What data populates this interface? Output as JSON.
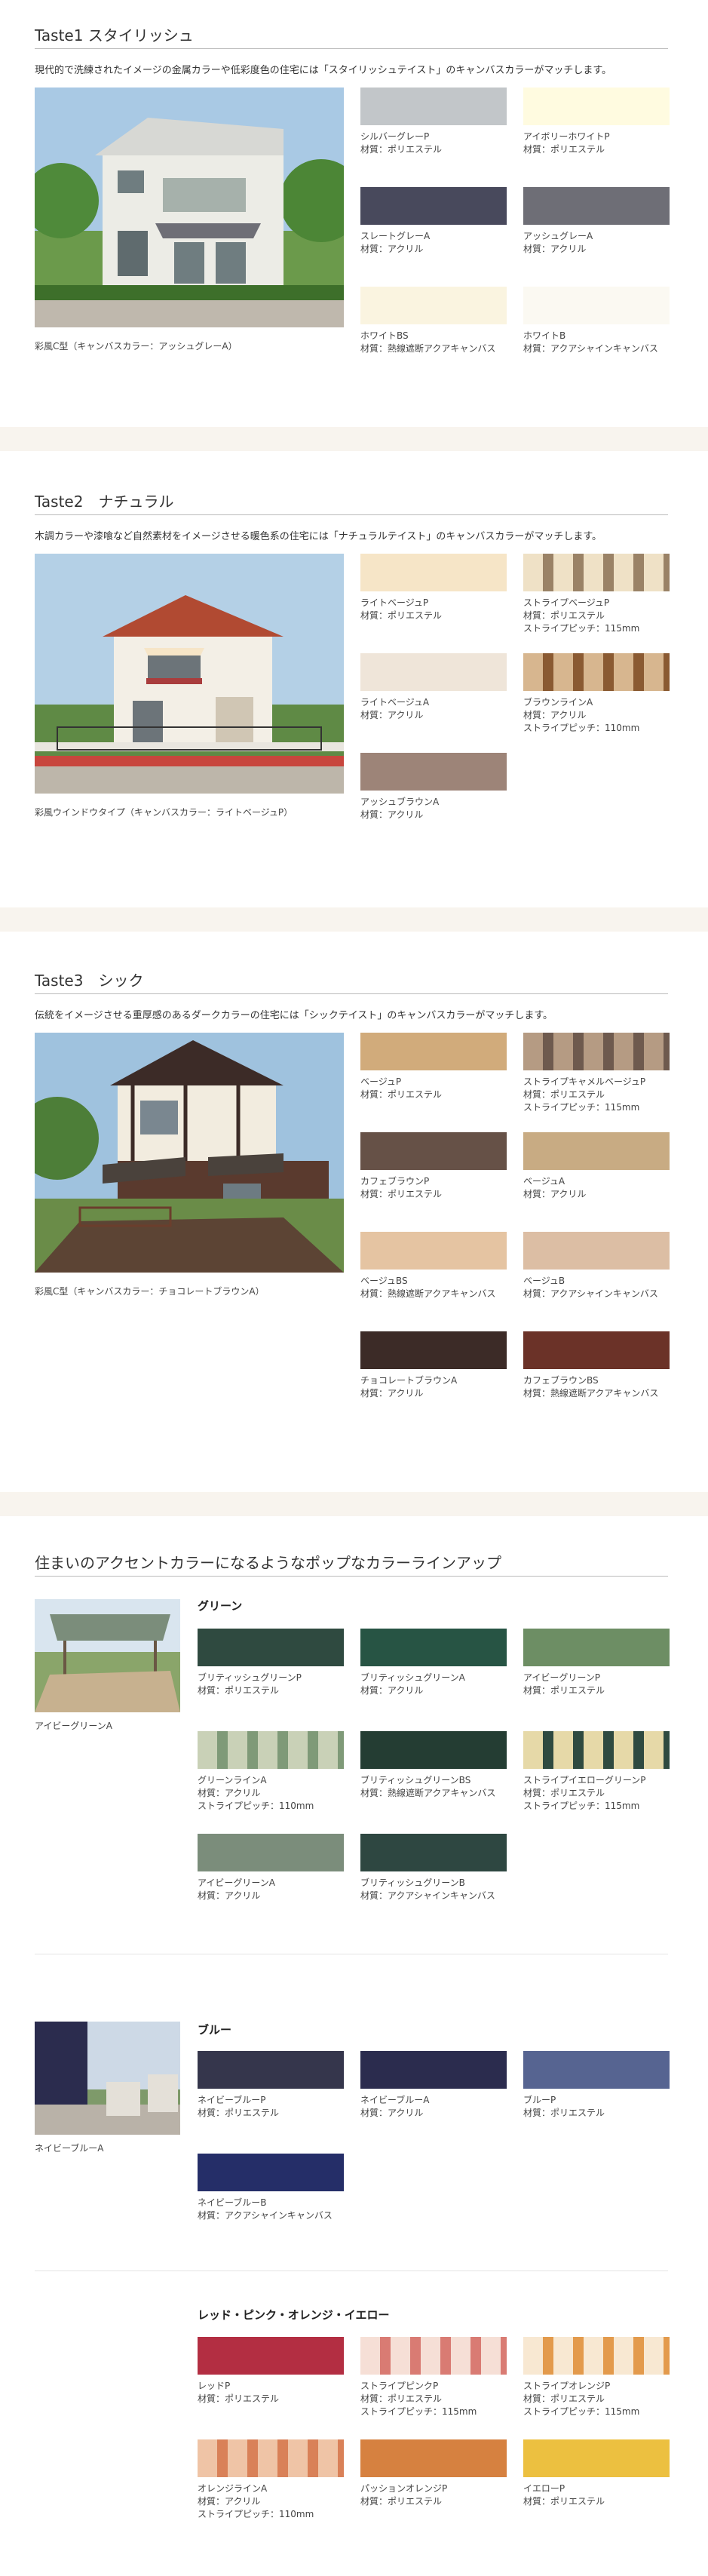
{
  "tastes": [
    {
      "title": "Taste1 スタイリッシュ",
      "desc": "現代的で洗練されたイメージの金属カラーや低彩度色の住宅には「スタイリッシュテイスト」のキャンバスカラーがマッチします。",
      "caption": "彩風C型（キャンバスカラー：アッシュグレーA）",
      "swatches": [
        {
          "name": "シルバーグレーP",
          "lines": [
            "材質：ポリエステル"
          ],
          "color": "#c2c6c9"
        },
        {
          "name": "アイボリーホワイトP",
          "lines": [
            "材質：ポリエステル"
          ],
          "color": "#fffbe0"
        },
        {
          "name": "スレートグレーA",
          "lines": [
            "材質：アクリル"
          ],
          "color": "#48495c"
        },
        {
          "name": "アッシュグレーA",
          "lines": [
            "材質：アクリル"
          ],
          "color": "#6e6e76"
        },
        {
          "name": "ホワイトBS",
          "lines": [
            "材質：熱線遮断アクアキャンバス"
          ],
          "color": "#faf4e0"
        },
        {
          "name": "ホワイトB",
          "lines": [
            "材質：アクアシャインキャンバス"
          ],
          "color": "#fbf9f2"
        }
      ]
    },
    {
      "title": "Taste2　ナチュラル",
      "desc": "木調カラーや漆喰など自然素材をイメージさせる暖色系の住宅には「ナチュラルテイスト」のキャンバスカラーがマッチします。",
      "caption": "彩風ウインドウタイプ（キャンバスカラー：ライトベージュP）",
      "swatches": [
        {
          "name": "ライトベージュP",
          "lines": [
            "材質：ポリエステル"
          ],
          "color": "#f6e5c7"
        },
        {
          "name": "ストライプベージュP",
          "lines": [
            "材質：ポリエステル",
            "ストライプピッチ：115mm"
          ],
          "color": "#efe1c6",
          "stripe": "#9a8266"
        },
        {
          "name": "ライトベージュA",
          "lines": [
            "材質：アクリル"
          ],
          "color": "#efe5d9"
        },
        {
          "name": "ブラウンラインA",
          "lines": [
            "材質：アクリル",
            "ストライプピッチ：110mm"
          ],
          "color": "#d7b68f",
          "stripe": "#8a5a32"
        },
        {
          "name": "アッシュブラウンA",
          "lines": [
            "材質：アクリル"
          ],
          "color": "#9d8478"
        }
      ]
    },
    {
      "title": "Taste3　シック",
      "desc": "伝統をイメージさせる重厚感のあるダークカラーの住宅には「シックテイスト」のキャンバスカラーがマッチします。",
      "caption": "彩風C型（キャンバスカラー：チョコレートブラウンA）",
      "swatches": [
        {
          "name": "ベージュP",
          "lines": [
            "材質：ポリエステル"
          ],
          "color": "#d1ab7b"
        },
        {
          "name": "ストライプキャメルベージュP",
          "lines": [
            "材質：ポリエステル",
            "ストライプピッチ：115mm"
          ],
          "color": "#b59b83",
          "stripe": "#6e5a4e"
        },
        {
          "name": "カフェブラウンP",
          "lines": [
            "材質：ポリエステル"
          ],
          "color": "#665147"
        },
        {
          "name": "ベージュA",
          "lines": [
            "材質：アクリル"
          ],
          "color": "#c8ab83"
        },
        {
          "name": "ベージュBS",
          "lines": [
            "材質：熱線遮断アクアキャンバス"
          ],
          "color": "#e5c4a2"
        },
        {
          "name": "ベージュB",
          "lines": [
            "材質：アクアシャインキャンバス"
          ],
          "color": "#dcbea4"
        },
        {
          "name": "チョコレートブラウンA",
          "lines": [
            "材質：アクリル"
          ],
          "color": "#3c2b27"
        },
        {
          "name": "カフェブラウンBS",
          "lines": [
            "材質：熱線遮断アクアキャンバス"
          ],
          "color": "#6b3228"
        }
      ]
    }
  ],
  "accent": {
    "title": "住まいのアクセントカラーになるようなポップなカラーラインアップ",
    "groups": [
      {
        "heading": "グリーン",
        "caption": "アイビーグリーンA",
        "swatches": [
          {
            "name": "ブリティッシュグリーンP",
            "lines": [
              "材質：ポリエステル"
            ],
            "color": "#2f4a40"
          },
          {
            "name": "ブリティッシュグリーンA",
            "lines": [
              "材質：アクリル"
            ],
            "color": "#275444"
          },
          {
            "name": "アイビーグリーンP",
            "lines": [
              "材質：ポリエステル"
            ],
            "color": "#6d8e64"
          },
          {
            "name": "グリーンラインA",
            "lines": [
              "材質：アクリル",
              "ストライプピッチ：110mm"
            ],
            "color": "#c9d1b7",
            "stripe": "#7f9a78"
          },
          {
            "name": "ブリティッシュグリーンBS",
            "lines": [
              "材質：熱線遮断アクアキャンバス"
            ],
            "color": "#243d33"
          },
          {
            "name": "ストライプイエローグリーンP",
            "lines": [
              "材質：ポリエステル",
              "ストライプピッチ：115mm"
            ],
            "color": "#e6d9a8",
            "stripe": "#2f4a40"
          },
          {
            "name": "アイビーグリーンA",
            "lines": [
              "材質：アクリル"
            ],
            "color": "#7b8d7b"
          },
          {
            "name": "ブリティッシュグリーンB",
            "lines": [
              "材質：アクアシャインキャンバス"
            ],
            "color": "#2e4741"
          }
        ]
      },
      {
        "heading": "ブルー",
        "caption": "ネイビーブルーA",
        "swatches": [
          {
            "name": "ネイビーブルーP",
            "lines": [
              "材質：ポリエステル"
            ],
            "color": "#35364c"
          },
          {
            "name": "ネイビーブルーA",
            "lines": [
              "材質：アクリル"
            ],
            "color": "#2b2c4e"
          },
          {
            "name": "ブルーP",
            "lines": [
              "材質：ポリエステル"
            ],
            "color": "#566491"
          },
          {
            "name": "ネイビーブルーB",
            "lines": [
              "材質：アクアシャインキャンバス"
            ],
            "color": "#252e68"
          }
        ]
      },
      {
        "heading": "レッド・ピンク・オレンジ・イエロー",
        "swatches": [
          {
            "name": "レッドP",
            "lines": [
              "材質：ポリエステル"
            ],
            "color": "#b32e42"
          },
          {
            "name": "ストライプピンクP",
            "lines": [
              "材質：ポリエステル",
              "ストライプピッチ：115mm"
            ],
            "color": "#f6dfd6",
            "stripe": "#d97b73"
          },
          {
            "name": "ストライプオレンジP",
            "lines": [
              "材質：ポリエステル",
              "ストライプピッチ：115mm"
            ],
            "color": "#f8e8d2",
            "stripe": "#e39a4c"
          },
          {
            "name": "オレンジラインA",
            "lines": [
              "材質：アクリル",
              "ストライプピッチ：110mm"
            ],
            "color": "#efc4a6",
            "stripe": "#d98158"
          },
          {
            "name": "パッションオレンジP",
            "lines": [
              "材質：ポリエステル"
            ],
            "color": "#d68140"
          },
          {
            "name": "イエローP",
            "lines": [
              "材質：ポリエステル"
            ],
            "color": "#ecc040"
          }
        ]
      }
    ]
  }
}
